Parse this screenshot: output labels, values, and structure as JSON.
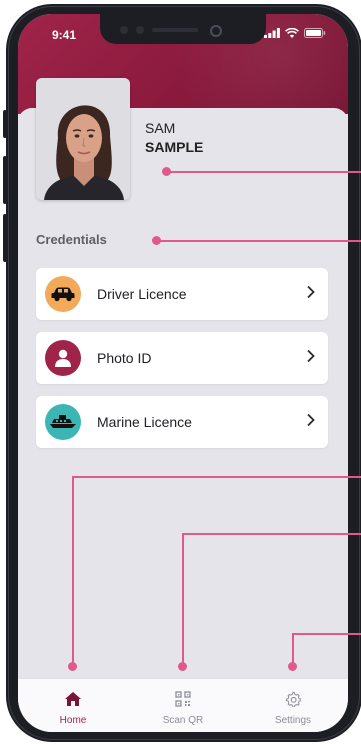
{
  "status_bar": {
    "time": "9:41"
  },
  "profile": {
    "first_name": "SAM",
    "last_name": "SAMPLE"
  },
  "credentials": {
    "title": "Credentials",
    "items": [
      {
        "label": "Driver Licence",
        "icon": "car-icon",
        "icon_bg": "#f2aa5a"
      },
      {
        "label": "Photo ID",
        "icon": "person-icon",
        "icon_bg": "#a0244a"
      },
      {
        "label": "Marine Licence",
        "icon": "boat-icon",
        "icon_bg": "#3bb6b4"
      }
    ]
  },
  "tabbar": {
    "tabs": [
      {
        "label": "Home",
        "icon": "home-icon",
        "active": true
      },
      {
        "label": "Scan QR",
        "icon": "qr-icon",
        "active": false
      },
      {
        "label": "Settings",
        "icon": "gear-icon",
        "active": false
      }
    ]
  },
  "colors": {
    "brand": "#a0244a",
    "callout": "#e0588d",
    "background": "#e5e4ea"
  }
}
